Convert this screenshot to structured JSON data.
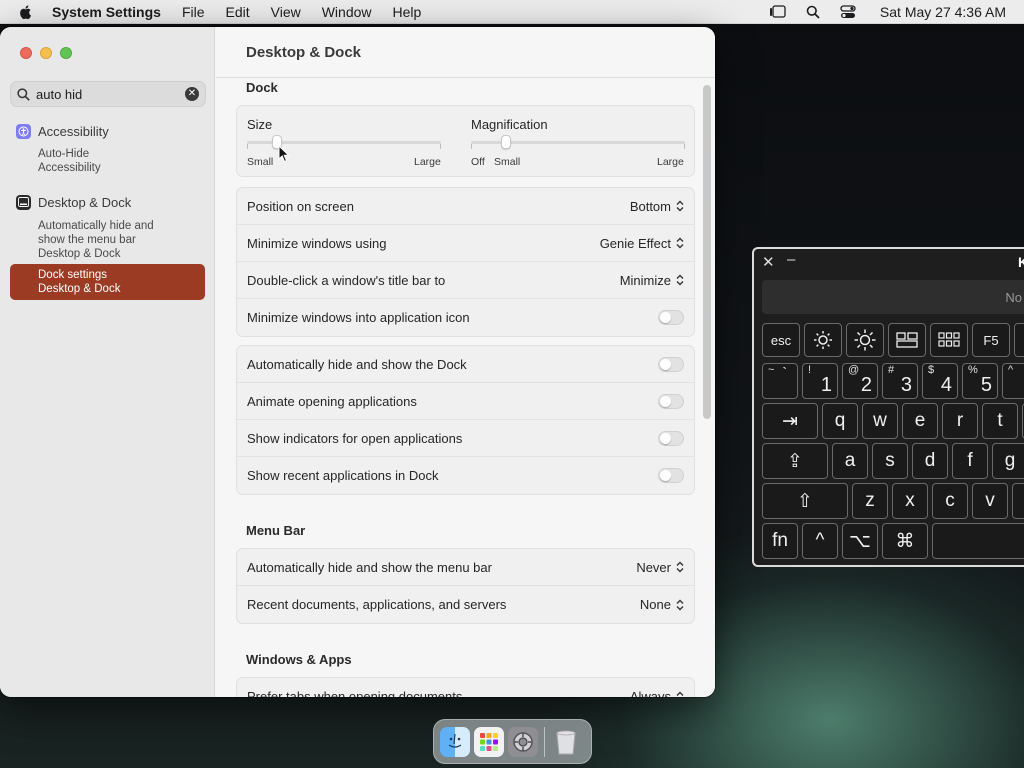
{
  "menubar": {
    "app_name": "System Settings",
    "items": [
      "File",
      "Edit",
      "View",
      "Window",
      "Help"
    ],
    "datetime": "Sat May 27  4:36 AM"
  },
  "sidebar": {
    "search_value": "auto hid",
    "groups": [
      {
        "category": "Accessibility",
        "icon": "accessibility-icon",
        "results": [
          {
            "title": "Auto-Hide",
            "sub": "Accessibility"
          }
        ]
      },
      {
        "category": "Desktop & Dock",
        "icon": "desktop-dock-icon",
        "results": [
          {
            "title": "Automatically hide and show the menu bar",
            "sub": "Desktop & Dock"
          }
        ]
      }
    ],
    "selected": {
      "title": "Dock settings",
      "sub": "Desktop & Dock"
    },
    "selected_color": "#9b3b23"
  },
  "main": {
    "title": "Desktop & Dock",
    "dock_section": "Dock",
    "size_slider": {
      "label": "Size",
      "min_label": "Small",
      "max_label": "Large",
      "value": 0.15
    },
    "magnification_slider": {
      "label": "Magnification",
      "off_label": "Off",
      "min_label": "Small",
      "max_label": "Large",
      "value": 0.16
    },
    "dock_rows": [
      {
        "label": "Position on screen",
        "value": "Bottom",
        "kind": "popup"
      },
      {
        "label": "Minimize windows using",
        "value": "Genie Effect",
        "kind": "popup"
      },
      {
        "label": "Double-click a window's title bar to",
        "value": "Minimize",
        "kind": "popup"
      },
      {
        "label": "Minimize windows into application icon",
        "kind": "toggle",
        "on": false
      }
    ],
    "dock_toggles": [
      {
        "label": "Automatically hide and show the Dock",
        "on": false
      },
      {
        "label": "Animate opening applications",
        "on": false
      },
      {
        "label": "Show indicators for open applications",
        "on": false
      },
      {
        "label": "Show recent applications in Dock",
        "on": false
      }
    ],
    "menu_bar_section": "Menu Bar",
    "menu_bar_rows": [
      {
        "label": "Automatically hide and show the menu bar",
        "value": "Never"
      },
      {
        "label": "Recent documents, applications, and servers",
        "value": "None"
      }
    ],
    "windows_section": "Windows & Apps",
    "windows_rows": [
      {
        "label": "Prefer tabs when opening documents",
        "value": "Always"
      }
    ]
  },
  "keyboard_viewer": {
    "title_partial": "K",
    "text_partial": "No",
    "keys": {
      "esc": "esc",
      "f5": "F5",
      "tilde_shift": "~",
      "tilde": "`",
      "num1_shift": "!",
      "num1": "1",
      "num2_shift": "@",
      "num2": "2",
      "num3_shift": "#",
      "num3": "3",
      "num4_shift": "$",
      "num4": "4",
      "num5_shift": "%",
      "num5": "5",
      "num6_shift": "^",
      "tab": "⇥",
      "q": "q",
      "w": "w",
      "e": "e",
      "r": "r",
      "t": "t",
      "caps": "⇪",
      "a": "a",
      "s": "s",
      "d": "d",
      "f": "f",
      "g": "g",
      "shift": "⇧",
      "z": "z",
      "x": "x",
      "c": "c",
      "v": "v",
      "fn": "fn",
      "control": "^",
      "option": "⌥",
      "command": "⌘"
    }
  },
  "dock_apps": [
    "finder-icon",
    "launchpad-icon",
    "system-settings-icon",
    "trash-icon"
  ]
}
